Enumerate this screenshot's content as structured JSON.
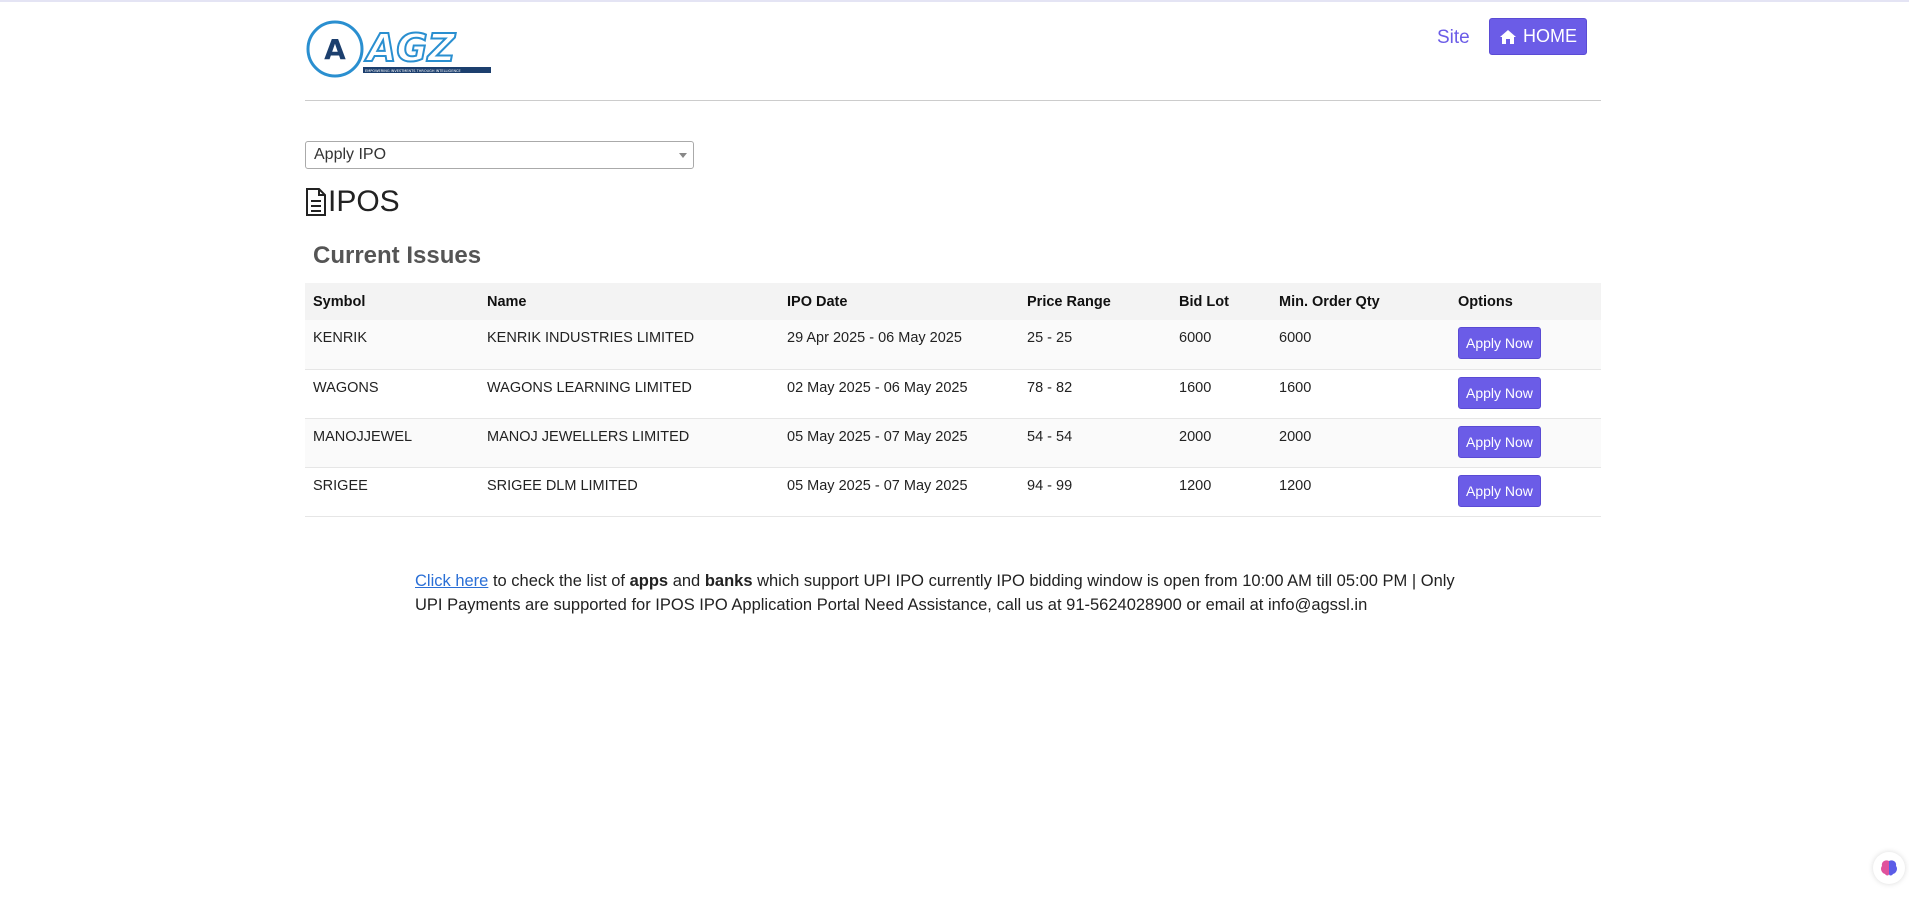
{
  "header": {
    "logo_text": "AGZ",
    "logo_tagline": "EMPOWERING INVESTMENTS THROUGH INTELLIGENCE",
    "site_link": "Site",
    "home_button": "HOME"
  },
  "selector": {
    "selected": "Apply IPO"
  },
  "page_title": "IPOS",
  "section_title": "Current Issues",
  "table": {
    "headers": [
      "Symbol",
      "Name",
      "IPO Date",
      "Price Range",
      "Bid Lot",
      "Min. Order Qty",
      "Options"
    ],
    "rows": [
      {
        "symbol": "KENRIK",
        "name": "KENRIK INDUSTRIES LIMITED",
        "date": "29 Apr 2025 - 06 May 2025",
        "price": "25 - 25",
        "bid_lot": "6000",
        "min_qty": "6000",
        "action": "Apply Now"
      },
      {
        "symbol": "WAGONS",
        "name": "WAGONS LEARNING LIMITED",
        "date": "02 May 2025 - 06 May 2025",
        "price": "78 - 82",
        "bid_lot": "1600",
        "min_qty": "1600",
        "action": "Apply Now"
      },
      {
        "symbol": "MANOJJEWEL",
        "name": "MANOJ JEWELLERS LIMITED",
        "date": "05 May 2025 - 07 May 2025",
        "price": "54 - 54",
        "bid_lot": "2000",
        "min_qty": "2000",
        "action": "Apply Now"
      },
      {
        "symbol": "SRIGEE",
        "name": "SRIGEE DLM LIMITED",
        "date": "05 May 2025 - 07 May 2025",
        "price": "94 - 99",
        "bid_lot": "1200",
        "min_qty": "1200",
        "action": "Apply Now"
      }
    ]
  },
  "note": {
    "link": "Click here",
    "part1": " to check the list of ",
    "bold1": "apps",
    "part2": " and ",
    "bold2": "banks",
    "part3": " which support UPI IPO currently IPO bidding window is open from 10:00 AM till 05:00 PM | Only UPI Payments are supported for IPOS IPO Application Portal Need Assistance, call us at 91-5624028900 or email at info@agssl.in"
  },
  "colors": {
    "accent": "#6b5ce7",
    "link": "#2a6fd6",
    "logo_blue": "#2a8fd0"
  }
}
